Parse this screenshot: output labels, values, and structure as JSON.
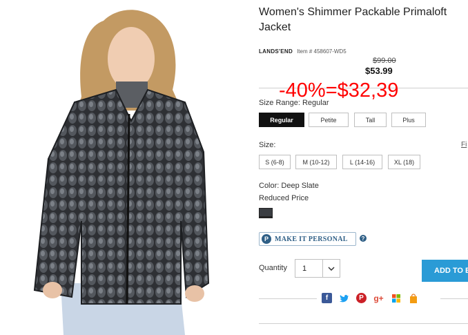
{
  "product": {
    "title": "Women's Shimmer Packable Primaloft Jacket",
    "brand": "LANDS'END",
    "item_number": "Item # 458607-WD5",
    "original_price": "$99.00",
    "sale_price": "$53.99",
    "discount_overlay": "-40%=$32,39"
  },
  "size_range": {
    "label": "Size Range: Regular",
    "options": [
      "Regular",
      "Petite",
      "Tall",
      "Plus"
    ],
    "selected": "Regular"
  },
  "size": {
    "label": "Size:",
    "options": [
      "S (6-8)",
      "M (10-12)",
      "L (14-16)",
      "XL (18)"
    ],
    "fit_link": "Fi"
  },
  "color": {
    "label": "Color: Deep Slate",
    "price_note": "Reduced Price",
    "swatch_color": "#3a3d42"
  },
  "personalize": {
    "icon_letter": "P",
    "label": "MAKE IT PERSONAL",
    "help": "?"
  },
  "quantity": {
    "label": "Quantity",
    "value": "1"
  },
  "cart": {
    "add_label": "ADD TO B"
  },
  "social_icons": [
    "facebook-icon",
    "twitter-icon",
    "pinterest-icon",
    "google-plus-icon",
    "microsoft-icon",
    "shopping-bag-icon"
  ],
  "colors": {
    "accent": "#2a9bd6",
    "overlay_red": "#ff0000",
    "personal_blue": "#2f5f86"
  }
}
